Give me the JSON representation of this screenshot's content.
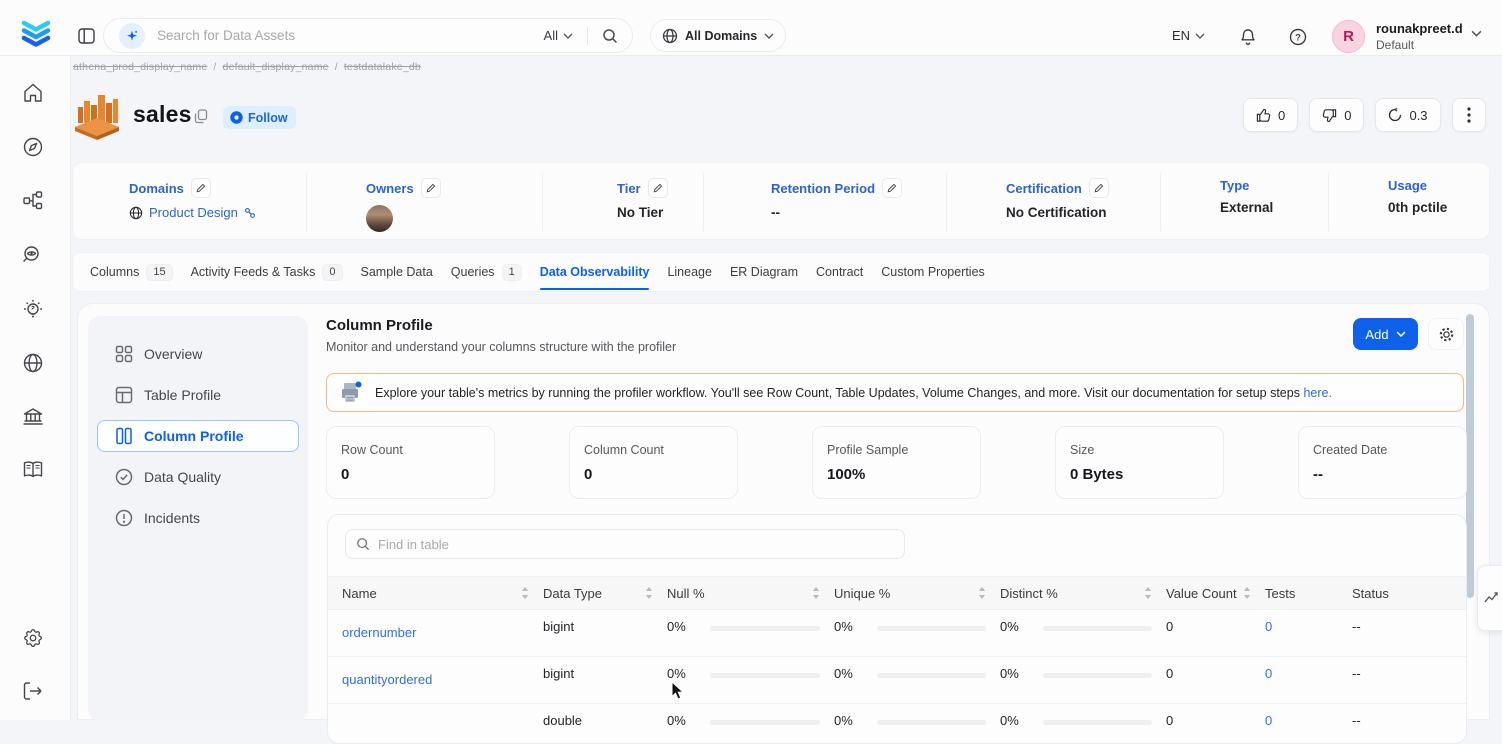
{
  "topbar": {
    "search_placeholder": "Search for Data Assets",
    "search_scope": "All",
    "domains_label": "All Domains",
    "language": "EN",
    "user": {
      "name": "rounakpreet.d",
      "role": "Default",
      "initial": "R"
    }
  },
  "breadcrumb": {
    "parts": [
      "athena_prod_display_name",
      "default_display_name",
      "testdatalake_db"
    ],
    "separator": "/"
  },
  "entity": {
    "title": "sales",
    "follow_label": "Follow",
    "upvotes": "0",
    "downvotes": "0",
    "version": "0.3"
  },
  "metadata": {
    "sections": [
      {
        "label": "Domains",
        "value": "Product Design",
        "editable": true,
        "kind": "domain"
      },
      {
        "label": "Owners",
        "value": "",
        "editable": true,
        "kind": "avatar"
      },
      {
        "label": "Tier",
        "value": "No Tier",
        "editable": true,
        "kind": "text"
      },
      {
        "label": "Retention Period",
        "value": "--",
        "editable": true,
        "kind": "text"
      },
      {
        "label": "Certification",
        "value": "No Certification",
        "editable": true,
        "kind": "text"
      },
      {
        "label": "Type",
        "value": "External",
        "editable": false,
        "kind": "text"
      },
      {
        "label": "Usage",
        "value": "0th pctile",
        "editable": false,
        "kind": "text"
      }
    ]
  },
  "tabs": [
    {
      "label": "Columns",
      "badge": "15"
    },
    {
      "label": "Activity Feeds & Tasks",
      "badge": "0"
    },
    {
      "label": "Sample Data"
    },
    {
      "label": "Queries",
      "badge": "1"
    },
    {
      "label": "Data Observability",
      "active": true
    },
    {
      "label": "Lineage"
    },
    {
      "label": "ER Diagram"
    },
    {
      "label": "Contract"
    },
    {
      "label": "Custom Properties"
    }
  ],
  "profile_nav": [
    {
      "label": "Overview",
      "icon": "grid"
    },
    {
      "label": "Table Profile",
      "icon": "table"
    },
    {
      "label": "Column Profile",
      "icon": "columns",
      "active": true
    },
    {
      "label": "Data Quality",
      "icon": "check"
    },
    {
      "label": "Incidents",
      "icon": "alert"
    }
  ],
  "content": {
    "title": "Column Profile",
    "subtitle": "Monitor and understand your columns structure with the profiler",
    "add_label": "Add",
    "banner_text": "Explore your table's metrics by running the profiler workflow. You'll see Row Count, Table Updates, Volume Changes, and more. Visit our documentation for setup steps ",
    "banner_link": "here."
  },
  "stats": [
    {
      "label": "Row Count",
      "value": "0"
    },
    {
      "label": "Column Count",
      "value": "0"
    },
    {
      "label": "Profile Sample",
      "value": "100%"
    },
    {
      "label": "Size",
      "value": "0 Bytes"
    },
    {
      "label": "Created Date",
      "value": "--"
    }
  ],
  "table": {
    "search_placeholder": "Find in table",
    "columns": [
      "Name",
      "Data Type",
      "Null %",
      "Unique %",
      "Distinct %",
      "Value Count",
      "Tests",
      "Status"
    ],
    "sortable": [
      true,
      true,
      true,
      true,
      true,
      true,
      false,
      false
    ],
    "rows": [
      {
        "name": "ordernumber",
        "type": "bigint",
        "null": "0%",
        "unique": "0%",
        "distinct": "0%",
        "value_count": "0",
        "tests": "0",
        "status": "--"
      },
      {
        "name": "quantityordered",
        "type": "bigint",
        "null": "0%",
        "unique": "0%",
        "distinct": "0%",
        "value_count": "0",
        "tests": "0",
        "status": "--"
      },
      {
        "name": "",
        "type": "double",
        "null": "0%",
        "unique": "0%",
        "distinct": "0%",
        "value_count": "0",
        "tests": "0",
        "status": "--"
      }
    ]
  }
}
